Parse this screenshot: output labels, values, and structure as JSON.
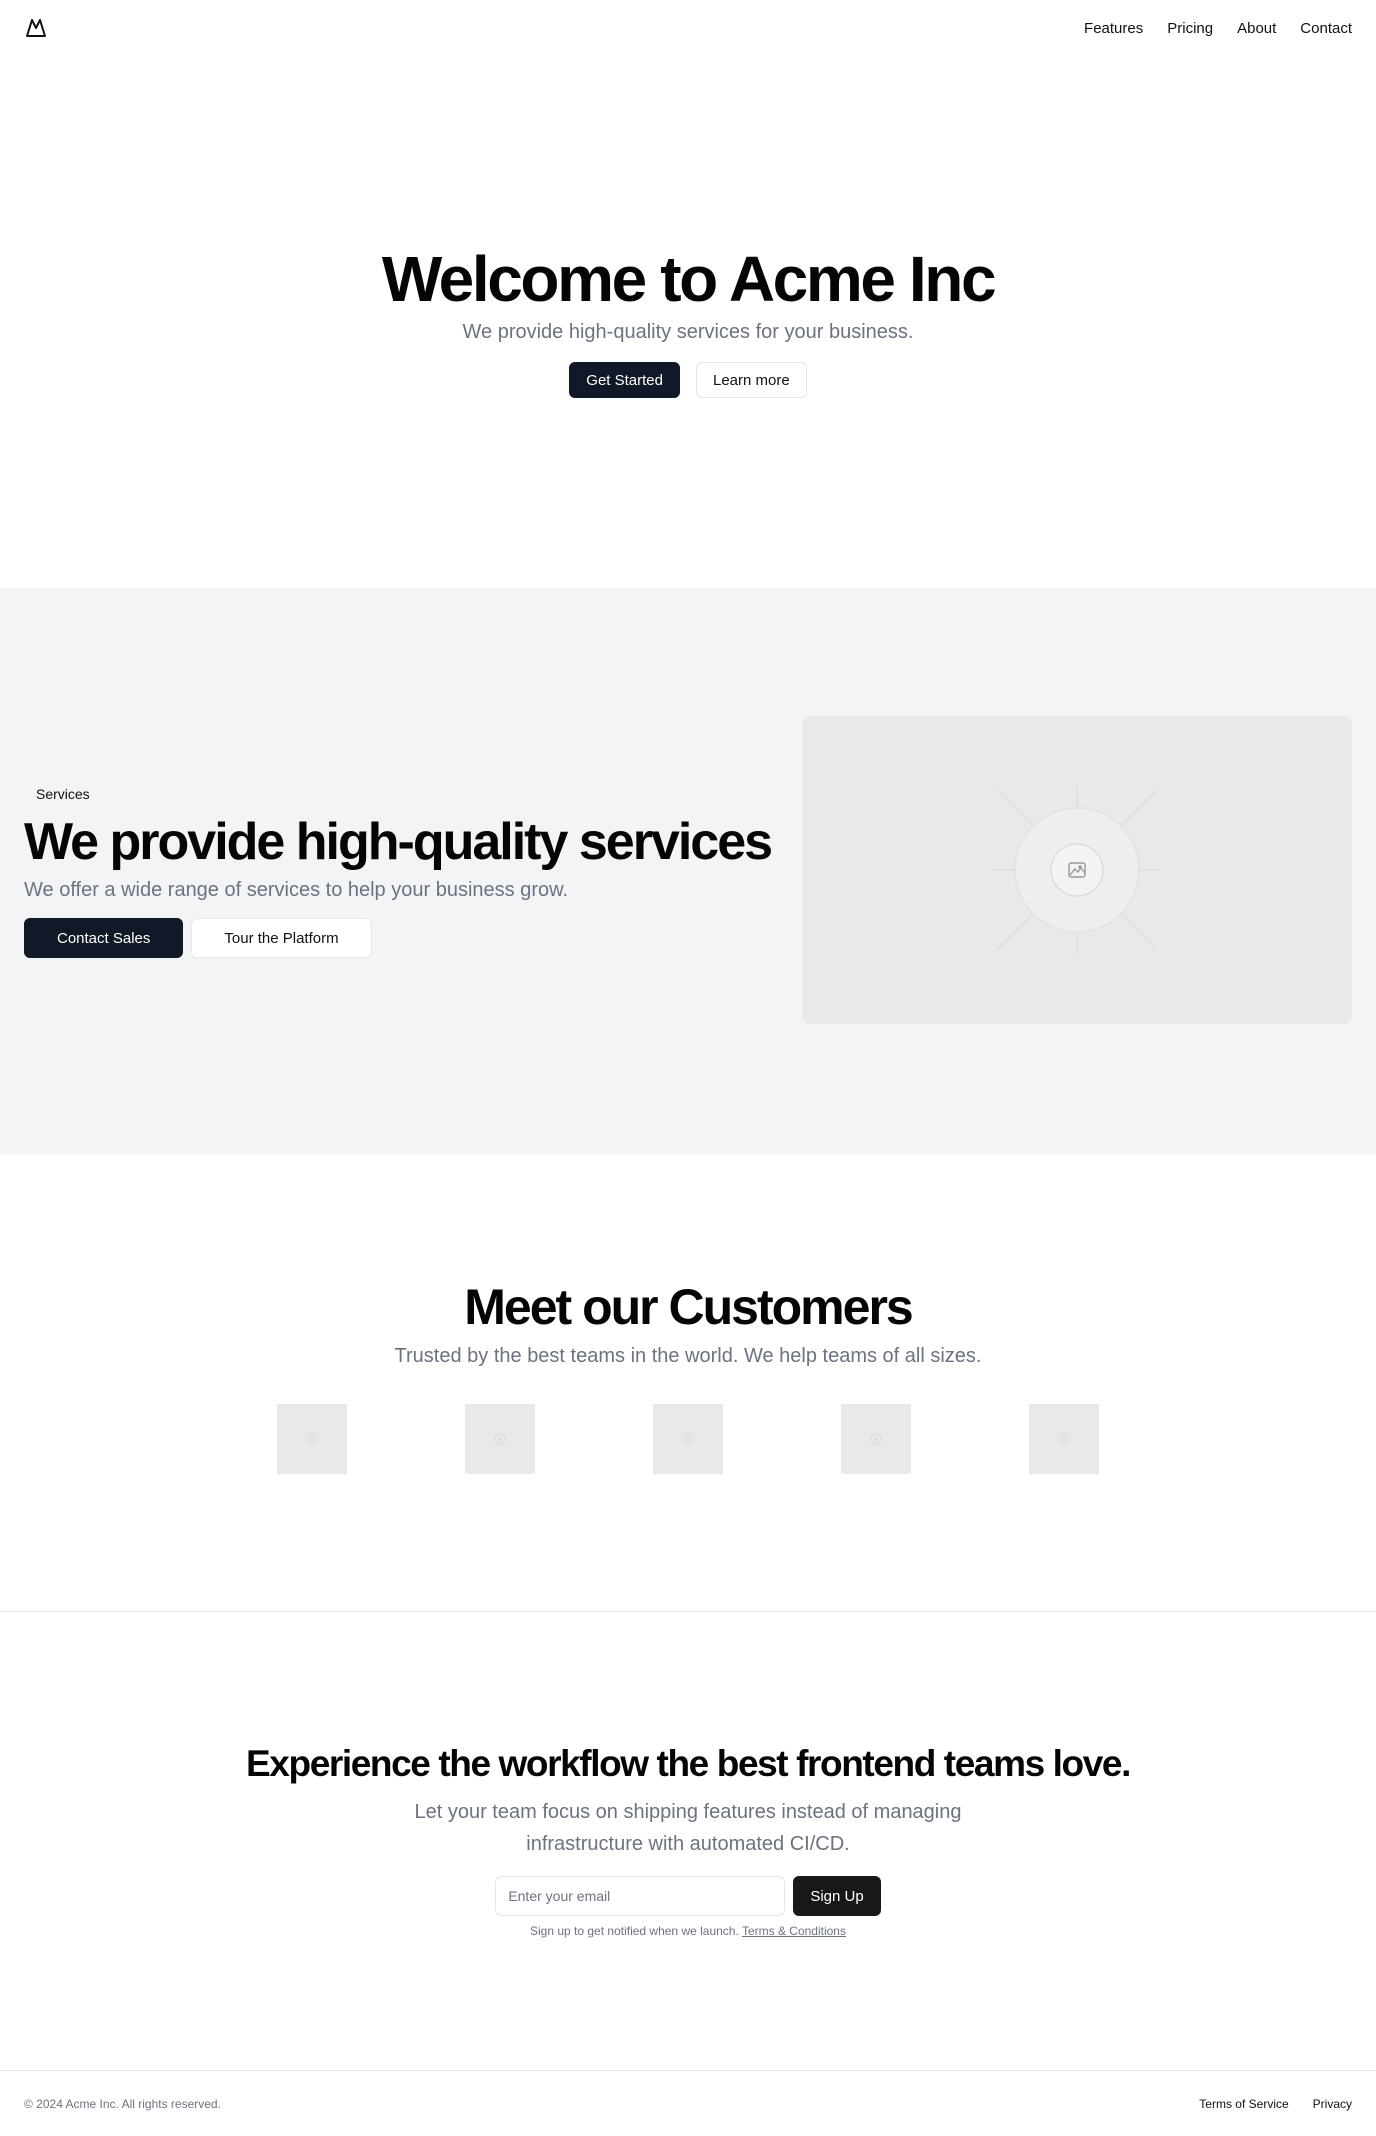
{
  "header": {
    "logo_icon": "mountain-icon",
    "nav": [
      {
        "label": "Features"
      },
      {
        "label": "Pricing"
      },
      {
        "label": "About"
      },
      {
        "label": "Contact"
      }
    ]
  },
  "hero": {
    "title": "Welcome to Acme Inc",
    "subtitle": "We provide high-quality services for your business.",
    "primary_button": "Get Started",
    "secondary_button": "Learn more"
  },
  "services": {
    "tag": "Services",
    "title": "We provide high-quality services",
    "subtitle": "We offer a wide range of services to help your business grow.",
    "primary_button": "Contact Sales",
    "secondary_button": "Tour the Platform",
    "image_icon": "image-placeholder-icon"
  },
  "customers": {
    "title": "Meet our Customers",
    "subtitle": "Trusted by the best teams in the world. We help teams of all sizes.",
    "logo_count": 5
  },
  "cta": {
    "title": "Experience the workflow the best frontend teams love.",
    "subtitle": "Let your team focus on shipping features instead of managing infrastructure with automated CI/CD.",
    "email_placeholder": "Enter your email",
    "signup_button": "Sign Up",
    "note": "Sign up to get notified when we launch.",
    "terms_link": "Terms & Conditions"
  },
  "footer": {
    "copyright": "© 2024 Acme Inc. All rights reserved.",
    "links": [
      {
        "label": "Terms of Service"
      },
      {
        "label": "Privacy"
      }
    ]
  },
  "colors": {
    "primary_button": "#111827",
    "section_background": "#f3f4f6",
    "muted_text": "#6b7280"
  }
}
